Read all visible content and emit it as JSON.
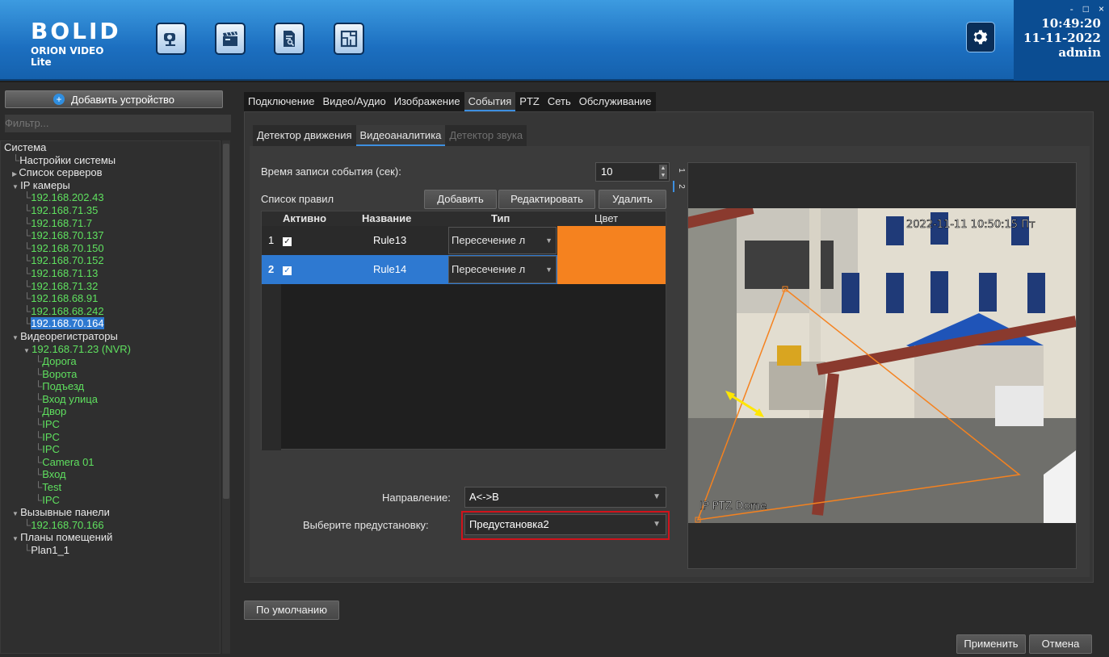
{
  "header": {
    "logo_mark": "BOLID",
    "logo_sub": "ORION VIDEO Lite",
    "toolbar_icons": [
      "camera-icon",
      "clapper-icon",
      "report-icon",
      "floorplan-icon"
    ],
    "settings_icon": "gear-icon",
    "time": "10:49:20",
    "date": "11-11-2022",
    "user": "admin",
    "window_buttons": [
      "-",
      "□",
      "×"
    ]
  },
  "sidebar": {
    "add_device_label": "Добавить устройство",
    "filter_placeholder": "Фильтр...",
    "tree": [
      {
        "label": "Система",
        "level": 0,
        "color": "white"
      },
      {
        "label": "Настройки системы",
        "level": 1,
        "color": "white"
      },
      {
        "label": "Список серверов",
        "level": 1,
        "color": "white",
        "expander": "right"
      },
      {
        "label": "IP камеры",
        "level": 1,
        "color": "white",
        "expander": "down"
      },
      {
        "label": "192.168.202.43",
        "level": 2,
        "color": "green"
      },
      {
        "label": "192.168.71.35",
        "level": 2,
        "color": "green"
      },
      {
        "label": "192.168.71.7",
        "level": 2,
        "color": "green"
      },
      {
        "label": "192.168.70.137",
        "level": 2,
        "color": "green"
      },
      {
        "label": "192.168.70.150",
        "level": 2,
        "color": "green"
      },
      {
        "label": "192.168.70.152",
        "level": 2,
        "color": "green"
      },
      {
        "label": "192.168.71.13",
        "level": 2,
        "color": "green"
      },
      {
        "label": "192.168.71.32",
        "level": 2,
        "color": "green"
      },
      {
        "label": "192.168.68.91",
        "level": 2,
        "color": "green"
      },
      {
        "label": "192.168.68.242",
        "level": 2,
        "color": "green"
      },
      {
        "label": "192.168.70.164",
        "level": 2,
        "color": "selected"
      },
      {
        "label": "Видеорегистраторы",
        "level": 1,
        "color": "white",
        "expander": "down"
      },
      {
        "label": "192.168.71.23 (NVR)",
        "level": 2,
        "color": "green",
        "expander": "down"
      },
      {
        "label": "Дорога",
        "level": 3,
        "color": "green"
      },
      {
        "label": "Ворота",
        "level": 3,
        "color": "green"
      },
      {
        "label": "Подъезд",
        "level": 3,
        "color": "green"
      },
      {
        "label": "Вход улица",
        "level": 3,
        "color": "green"
      },
      {
        "label": "Двор",
        "level": 3,
        "color": "green"
      },
      {
        "label": "IPC",
        "level": 3,
        "color": "green"
      },
      {
        "label": "IPC",
        "level": 3,
        "color": "green"
      },
      {
        "label": "IPC",
        "level": 3,
        "color": "green"
      },
      {
        "label": "Camera 01",
        "level": 3,
        "color": "green"
      },
      {
        "label": "Вход",
        "level": 3,
        "color": "green"
      },
      {
        "label": "Test",
        "level": 3,
        "color": "green"
      },
      {
        "label": "IPC",
        "level": 3,
        "color": "green"
      },
      {
        "label": "Вызывные панели",
        "level": 1,
        "color": "white",
        "expander": "down"
      },
      {
        "label": "192.168.70.166",
        "level": 2,
        "color": "green"
      },
      {
        "label": "Планы помещений",
        "level": 1,
        "color": "white",
        "expander": "down"
      },
      {
        "label": "Plan1_1",
        "level": 2,
        "color": "white"
      }
    ]
  },
  "main": {
    "tabs": [
      "Подключение",
      "Видео/Аудио",
      "Изображение",
      "События",
      "PTZ",
      "Сеть",
      "Обслуживание"
    ],
    "active_tab": 3,
    "subtabs": [
      "Детектор движения",
      "Видеоаналитика",
      "Детектор звука"
    ],
    "active_subtab": 1,
    "record_time_label": "Время записи события (сек):",
    "record_time_value": "10",
    "rules_label": "Список правил",
    "add_button": "Добавить",
    "edit_button": "Редактировать",
    "delete_button": "Удалить",
    "grid_headers": {
      "active": "Активно",
      "name": "Название",
      "type": "Тип",
      "color": "Цвет"
    },
    "rules": [
      {
        "num": "1",
        "active": true,
        "name": "Rule13",
        "type": "Пересечение л",
        "color": "#f5821f"
      },
      {
        "num": "2",
        "active": true,
        "name": "Rule14",
        "type": "Пересечение л",
        "color": "#f5821f"
      }
    ],
    "direction_label": "Направление:",
    "direction_value": "A<->B",
    "preset_label": "Выберите предустановку:",
    "preset_value": "Предустановка2",
    "video_tabs": [
      "1",
      "2"
    ],
    "video_timestamp": "2022-11-11 10:50:15 Пт",
    "video_caption": "IP PTZ Dome",
    "default_button": "По умолчанию",
    "apply_button": "Применить",
    "cancel_button": "Отмена"
  },
  "colors": {
    "accent": "#2e79d1",
    "online": "#5fe05f",
    "rule_color": "#f5821f",
    "highlight_box": "#d0131b"
  }
}
